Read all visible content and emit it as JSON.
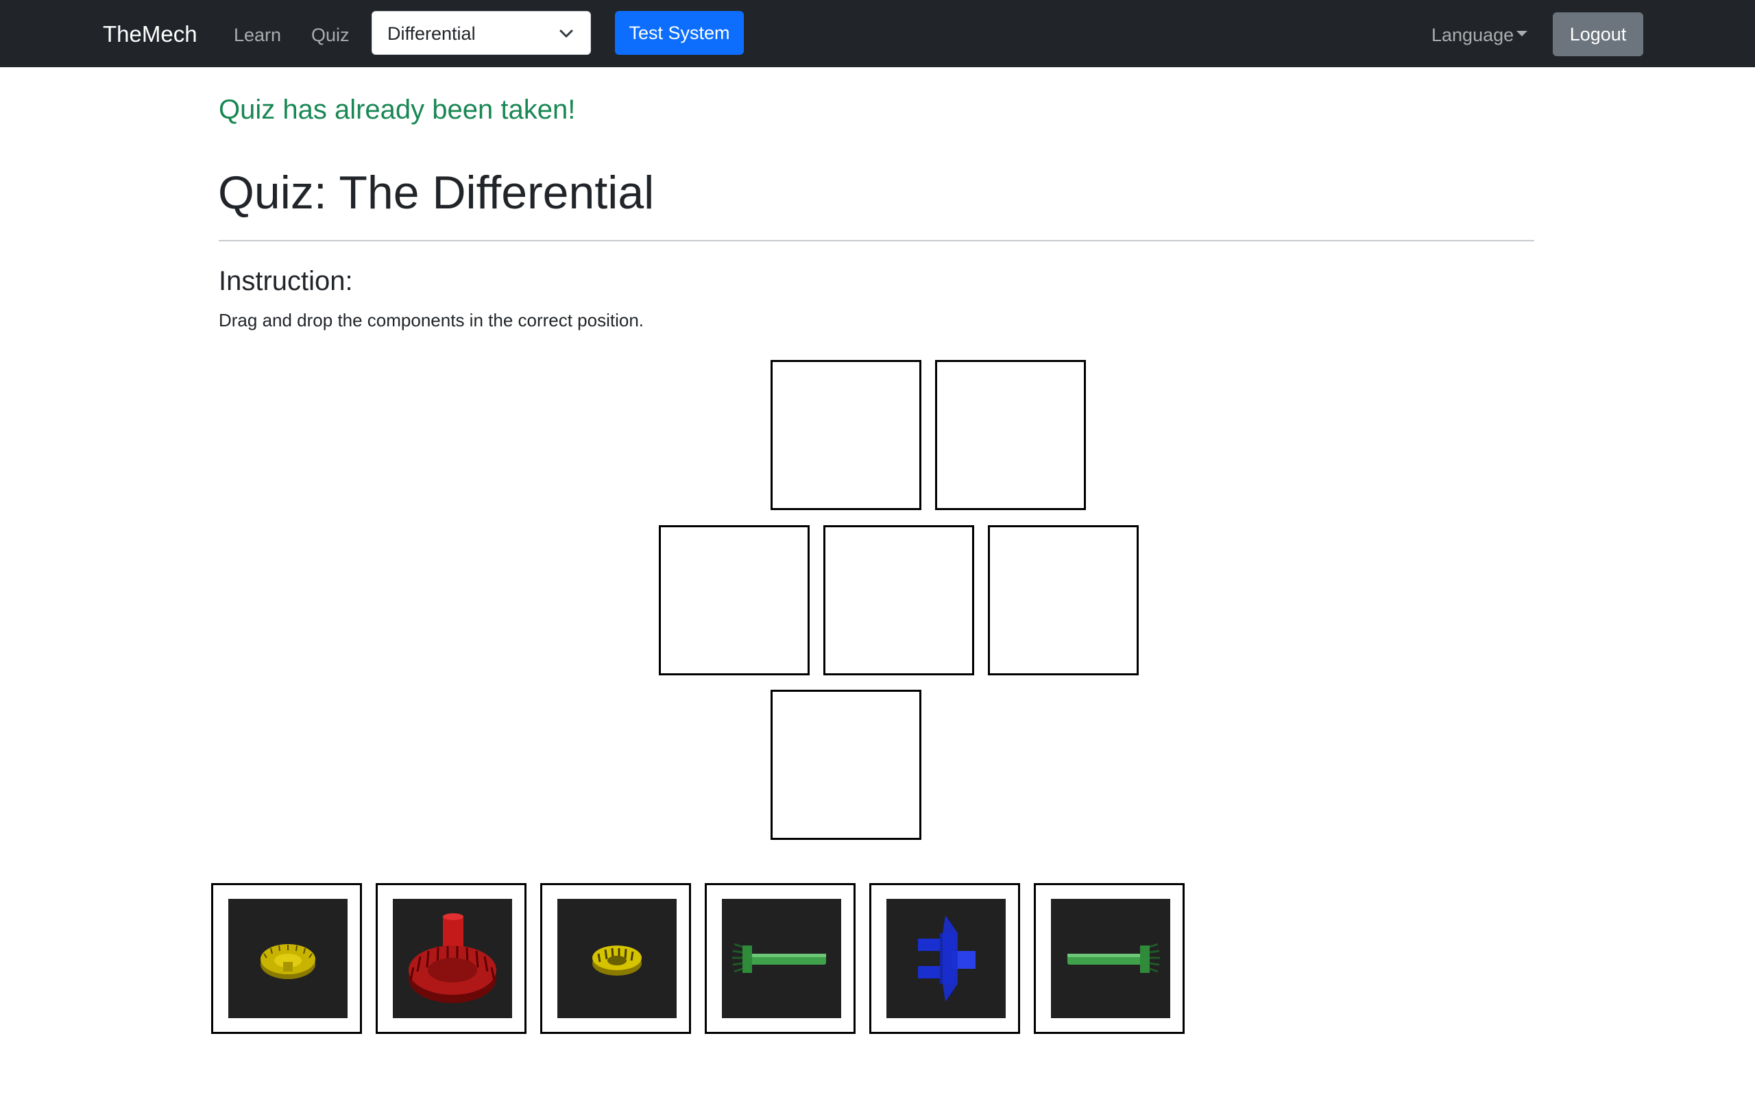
{
  "navbar": {
    "brand": "TheMech",
    "links": [
      {
        "label": "Learn"
      },
      {
        "label": "Quiz"
      }
    ],
    "system_select": {
      "value": "Differential"
    },
    "test_button": "Test System",
    "language": "Language",
    "logout": "Logout"
  },
  "status_message": "Quiz has already been taken!",
  "page_title": "Quiz: The Differential",
  "instruction": {
    "heading": "Instruction:",
    "text": "Drag and drop the components in the correct position."
  },
  "drop_slots": [
    {
      "filled": false
    },
    {
      "filled": false
    },
    {
      "filled": false
    },
    {
      "filled": false
    },
    {
      "filled": false
    },
    {
      "filled": false
    }
  ],
  "components": [
    {
      "icon": "small-bevel-gear-icon",
      "color": "#c8b400"
    },
    {
      "icon": "ring-gear-icon",
      "color": "#b01818"
    },
    {
      "icon": "small-bevel-gear-icon",
      "color": "#d6c300"
    },
    {
      "icon": "axle-shaft-left-icon",
      "color": "#3fa14a"
    },
    {
      "icon": "pinion-drive-shaft-icon",
      "color": "#1a2fd0"
    },
    {
      "icon": "axle-shaft-right-icon",
      "color": "#3fa14a"
    }
  ],
  "colors": {
    "navbar_bg": "#212529",
    "primary": "#0d6efd",
    "secondary": "#6c757d",
    "success": "#198754"
  }
}
